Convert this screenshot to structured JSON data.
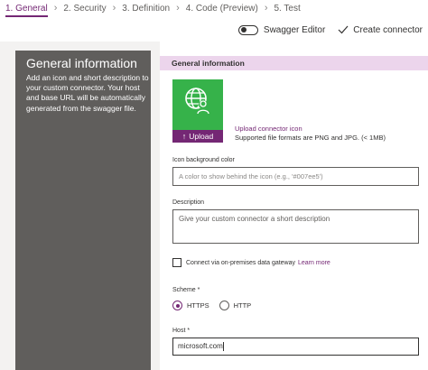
{
  "steps": [
    {
      "label": "1. General",
      "active": true
    },
    {
      "label": "2. Security",
      "active": false
    },
    {
      "label": "3. Definition",
      "active": false
    },
    {
      "label": "4. Code (Preview)",
      "active": false
    },
    {
      "label": "5. Test",
      "active": false
    }
  ],
  "step_separator": "›",
  "toolbar": {
    "swagger_label": "Swagger Editor",
    "swagger_on": false,
    "create_label": "Create connector"
  },
  "left": {
    "title": "General information",
    "description": "Add an icon and short description to your custom connector. Your host and base URL will be automatically generated from the swagger file."
  },
  "form": {
    "section_title": "General information",
    "icon_name": "globe-user-icon",
    "icon_tile_color": "#36b24a",
    "upload_button": "Upload",
    "upload_link": "Upload connector icon",
    "formats_text": "Supported file formats are PNG and JPG. (< 1MB)",
    "bg_color_label": "Icon background color",
    "bg_color_placeholder": "A color to show behind the icon (e.g., '#007ee5')",
    "description_label": "Description",
    "description_placeholder": "Give your custom connector a short description",
    "gateway_label": "Connect via on-premises data gateway",
    "gateway_checked": false,
    "learn_more": "Learn more",
    "scheme_label": "Scheme *",
    "scheme_options": [
      {
        "label": "HTTPS",
        "selected": true
      },
      {
        "label": "HTTP",
        "selected": false
      }
    ],
    "host_label": "Host *",
    "host_value": "microsoft.com"
  },
  "colors": {
    "accent": "#742774",
    "header_bg": "#ecd5ec",
    "left_panel_bg": "#605e5c"
  }
}
